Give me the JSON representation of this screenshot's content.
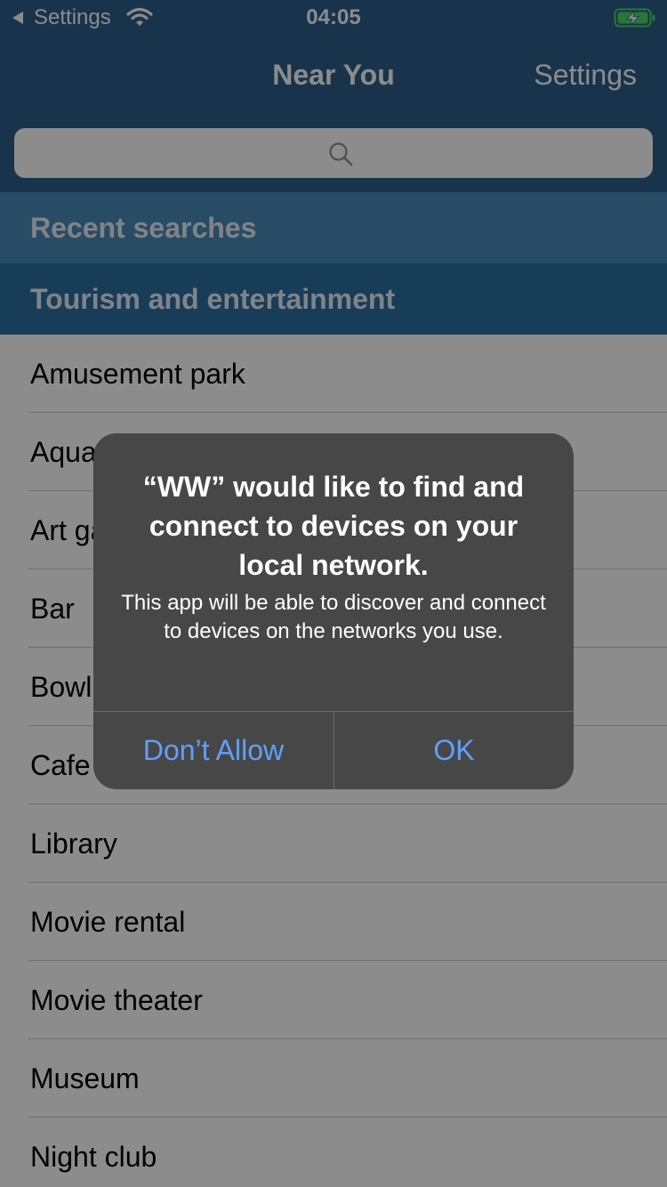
{
  "status_bar": {
    "back_label": "Settings",
    "time": "04:05"
  },
  "nav": {
    "title": "Near You",
    "settings_label": "Settings"
  },
  "search": {
    "placeholder": ""
  },
  "sections": {
    "recent": "Recent searches",
    "tourism": "Tourism and entertainment"
  },
  "list": {
    "items": [
      "Amusement park",
      "Aquarium",
      "Art gallery",
      "Bar",
      "Bowling alley",
      "Cafe",
      "Library",
      "Movie rental",
      "Movie theater",
      "Museum",
      "Night club"
    ]
  },
  "alert": {
    "title": "“WW” would like to find and connect to devices on your local network.",
    "message": "This app will be able to discover and connect to devices on the networks you use.",
    "dont_allow_label": "Don’t Allow",
    "ok_label": "OK"
  },
  "colors": {
    "header": "#2c5f8b",
    "recent_section": "#4a8bb9",
    "tourism_section": "#2d6fa3",
    "alert_bg": "#474747",
    "alert_button": "#5ea0ff",
    "battery_charging": "#4cd964"
  },
  "icons": {
    "back": "back-arrow-icon",
    "wifi": "wifi-icon",
    "battery": "battery-charging-icon",
    "search": "search-icon"
  }
}
